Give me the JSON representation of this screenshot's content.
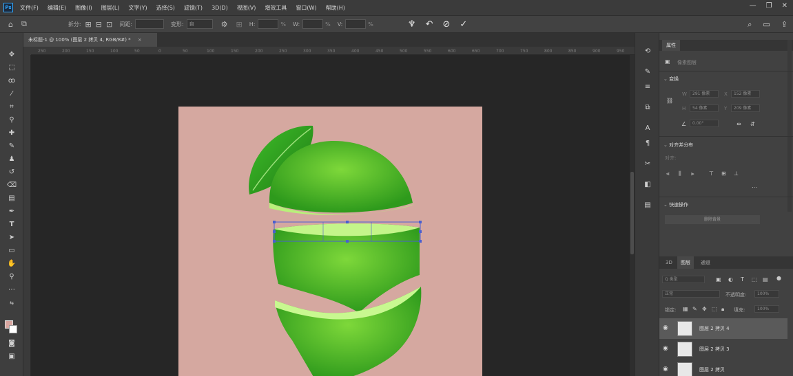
{
  "app": {
    "logo_text": "Ps"
  },
  "menu": {
    "items": [
      "文件(F)",
      "编辑(E)",
      "图像(I)",
      "图层(L)",
      "文字(Y)",
      "选择(S)",
      "滤镜(T)",
      "3D(D)",
      "视图(V)",
      "增效工具",
      "窗口(W)",
      "帮助(H)"
    ]
  },
  "window_controls": {
    "minimize": "—",
    "restore": "❐",
    "close": "✕"
  },
  "options": {
    "home": "⌂",
    "transform_label": "拆分:",
    "interp_label": "间距:",
    "warp_label": "变形:",
    "warp_value": "自",
    "h_label": "H:",
    "w_label": "W:",
    "v_label": "V:",
    "unit": "%",
    "commit": "✓",
    "cancel": "⊘",
    "undo": "↶"
  },
  "document": {
    "tab_title": "未标题-1 @ 100% (图层 2 拷贝 4, RGB/8#) *",
    "tab_close": "×",
    "bg_color": "#d5a8a0"
  },
  "ruler_ticks": [
    "250",
    "200",
    "150",
    "100",
    "50",
    "0",
    "50",
    "100",
    "150",
    "200",
    "250",
    "300",
    "350",
    "400",
    "450",
    "500",
    "550",
    "600",
    "650",
    "700",
    "750",
    "800",
    "850",
    "900",
    "950"
  ],
  "properties": {
    "tab": "属性",
    "pixel_layer": "像素图层",
    "transform_title": "变换",
    "w_label": "W",
    "h_label": "H",
    "x_label": "X",
    "y_label": "Y",
    "w_value": "291 像素",
    "h_value": "54 像素",
    "x_value": "152 像素",
    "y_value": "209 像素",
    "angle_value": "0.00°",
    "align_title": "对齐并分布",
    "align_sub": "对齐:",
    "quick_title": "快速操作",
    "quick_button": "删除背景"
  },
  "layers": {
    "tabs": [
      "3D",
      "图层",
      "通道"
    ],
    "filter_label": "Q 类型",
    "blend_mode": "正常",
    "opacity_label": "不透明度:",
    "opacity_value": "100%",
    "lock_label": "锁定:",
    "fill_label": "填充:",
    "fill_value": "100%",
    "items": [
      {
        "name": "图层 2 拷贝 4",
        "selected": true
      },
      {
        "name": "图层 2 拷贝 3",
        "selected": false
      },
      {
        "name": "图层 2 拷贝",
        "selected": false
      }
    ]
  },
  "colors": {
    "foreground": "#d8a6a0",
    "background": "#ffffff",
    "lime_dark": "#2e9a1c",
    "lime_light": "#8fe04a",
    "selection": "#4a5fd0"
  }
}
